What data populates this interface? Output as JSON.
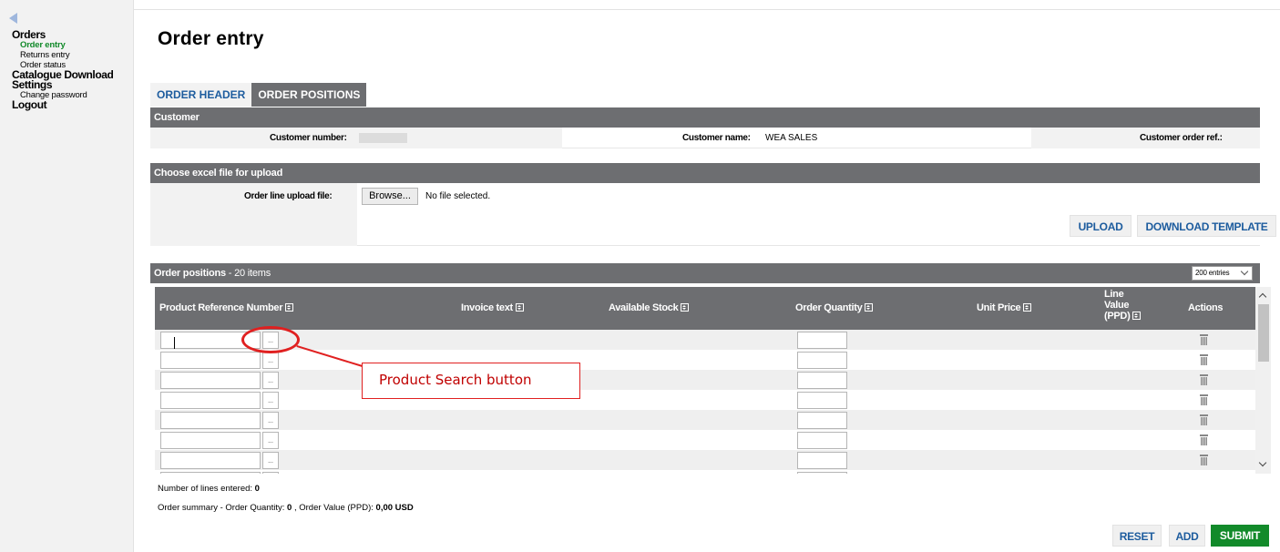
{
  "sidebar": {
    "groups": [
      {
        "label": "Orders",
        "items": [
          {
            "label": "Order entry",
            "active": true
          },
          {
            "label": "Returns entry",
            "active": false
          },
          {
            "label": "Order status",
            "active": false
          }
        ]
      },
      {
        "label": "Catalogue Download",
        "items": []
      },
      {
        "label": "Settings",
        "items": [
          {
            "label": "Change password",
            "active": false
          }
        ]
      },
      {
        "label": "Logout",
        "items": []
      }
    ]
  },
  "page_title": "Order entry",
  "tabs": [
    {
      "label": "ORDER HEADER",
      "active": false
    },
    {
      "label": "ORDER POSITIONS",
      "active": true
    }
  ],
  "customer": {
    "section_title": "Customer",
    "number_label": "Customer number:",
    "name_label": "Customer name:",
    "name_value": "WEA SALES",
    "order_ref_label": "Customer order ref.:"
  },
  "upload": {
    "section_title": "Choose excel file for upload",
    "field_label": "Order line upload file:",
    "browse_label": "Browse...",
    "file_status": "No file selected.",
    "upload_button": "UPLOAD",
    "template_button": "DOWNLOAD TEMPLATE"
  },
  "positions": {
    "section_title": "Order positions",
    "count_text": " - 20 items",
    "entries_selected": "200 entries",
    "columns": [
      "Product Reference Number",
      "Invoice text",
      "Available Stock",
      "Order Quantity",
      "Unit Price",
      "Line Value (PPD)",
      "Actions"
    ],
    "search_button_glyph": "..."
  },
  "summary": {
    "lines_label": "Number of lines entered:",
    "lines_value": "0",
    "order_summary_prefix": "Order summary - Order Quantity:",
    "quantity_value": "0",
    "value_label": ", Order Value (PPD):",
    "value_value": "0,00 USD"
  },
  "actions": {
    "reset": "RESET",
    "add": "ADD",
    "submit": "SUBMIT"
  },
  "annotation": {
    "callout_text": "Product Search button"
  },
  "colors": {
    "header_gray": "#6d6e71",
    "link_blue": "#1d5c9e",
    "active_green": "#128a2a",
    "annotation_red": "#e02020"
  }
}
